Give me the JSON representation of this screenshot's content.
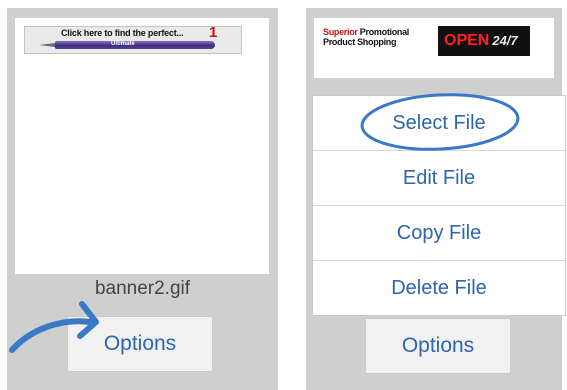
{
  "left_card": {
    "banner": {
      "headline": "Click here to find the perfect...",
      "number": "1",
      "pen_text": "Ultimate"
    },
    "filename": "banner2.gif",
    "options_label": "Options"
  },
  "right_card": {
    "banner": {
      "brand_line1_red": "Superior",
      "brand_line1_rest": " Promotional",
      "brand_line2": "Product Shopping",
      "open_text": "OPEN",
      "open_hours": "24/7"
    },
    "options_label": "Options",
    "menu": [
      {
        "label": "Select File"
      },
      {
        "label": "Edit File"
      },
      {
        "label": "Copy File"
      },
      {
        "label": "Delete File"
      }
    ]
  },
  "colors": {
    "link_blue": "#2d65b1",
    "annotation_blue": "#3a78c8",
    "card_gray": "#cfcfcf"
  }
}
